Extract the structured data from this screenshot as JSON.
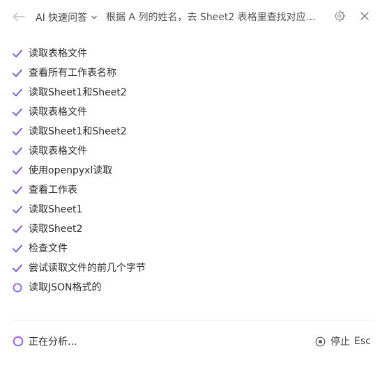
{
  "header": {
    "mode_label": "AI 快速问答",
    "query_text": "根据 A 列的姓名，去 Sheet2 表格里查找对应的工资..."
  },
  "steps": [
    {
      "label": "读取表格文件",
      "status": "done"
    },
    {
      "label": "查看所有工作表名称",
      "status": "done"
    },
    {
      "label": "读取Sheet1和Sheet2",
      "status": "done"
    },
    {
      "label": "读取表格文件",
      "status": "done"
    },
    {
      "label": "读取Sheet1和Sheet2",
      "status": "done"
    },
    {
      "label": "读取表格文件",
      "status": "done"
    },
    {
      "label": "使用openpyxl读取",
      "status": "done"
    },
    {
      "label": "查看工作表",
      "status": "done"
    },
    {
      "label": "读取Sheet1",
      "status": "done"
    },
    {
      "label": "读取Sheet2",
      "status": "done"
    },
    {
      "label": "检查文件",
      "status": "done"
    },
    {
      "label": "尝试读取文件的前几个字节",
      "status": "done"
    },
    {
      "label": "读取JSON格式的",
      "status": "in-progress"
    }
  ],
  "footer": {
    "status_label": "正在分析...",
    "stop_label": "停止",
    "stop_shortcut": "Esc"
  },
  "colors": {
    "accent": "#7b4ae2",
    "gradient_start": "#4f7cf7",
    "gradient_end": "#c04fe3"
  },
  "icons": {
    "back": "arrow-left-icon",
    "dropdown": "chevron-down-icon",
    "settings": "gear-icon",
    "close": "close-icon",
    "done": "check-icon",
    "loading": "spinner-icon",
    "stop": "stop-circle-icon"
  }
}
